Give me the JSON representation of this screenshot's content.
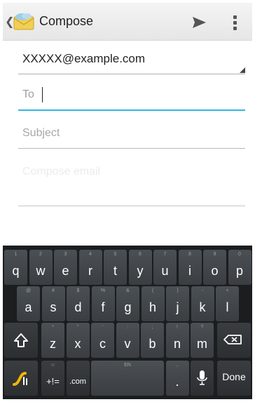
{
  "action_bar": {
    "title": "Compose",
    "icons": [
      "back-chevron-icon",
      "email-app-icon",
      "send-icon",
      "overflow-menu-icon"
    ]
  },
  "compose": {
    "from_account": "XXXXX@example.com",
    "to_label": "To",
    "to_value": "",
    "subject_placeholder": "Subject",
    "subject_value": "",
    "body_placeholder": "Compose email"
  },
  "keyboard": {
    "row1": [
      {
        "main": "q",
        "hint": "1"
      },
      {
        "main": "w",
        "hint": "2"
      },
      {
        "main": "e",
        "hint": "3"
      },
      {
        "main": "r",
        "hint": "4"
      },
      {
        "main": "t",
        "hint": "5"
      },
      {
        "main": "y",
        "hint": "6"
      },
      {
        "main": "u",
        "hint": "7"
      },
      {
        "main": "i",
        "hint": "8"
      },
      {
        "main": "o",
        "hint": "9"
      },
      {
        "main": "p",
        "hint": "0"
      }
    ],
    "row2": [
      {
        "main": "a",
        "hint": "@"
      },
      {
        "main": "s",
        "hint": "#"
      },
      {
        "main": "d",
        "hint": "$"
      },
      {
        "main": "f",
        "hint": "%"
      },
      {
        "main": "g",
        "hint": "&"
      },
      {
        "main": "h",
        "hint": "("
      },
      {
        "main": "j",
        "hint": ")"
      },
      {
        "main": "k",
        "hint": "-"
      },
      {
        "main": "l",
        "hint": "+"
      }
    ],
    "row3": [
      {
        "main": "z",
        "hint": "*"
      },
      {
        "main": "x",
        "hint": "\""
      },
      {
        "main": "c",
        "hint": "'"
      },
      {
        "main": "v",
        "hint": ":"
      },
      {
        "main": "b",
        "hint": ";"
      },
      {
        "main": "n",
        "hint": "!"
      },
      {
        "main": "m",
        "hint": "?"
      }
    ],
    "bottom": {
      "symbols_label": "+!=",
      "dotcom_label": ".com",
      "space_hint": "EN",
      "period_label": ".",
      "period_hint": ",",
      "done_label": "Done"
    },
    "icons": [
      "swype-icon",
      "shift-icon",
      "backspace-icon",
      "microphone-icon"
    ]
  }
}
